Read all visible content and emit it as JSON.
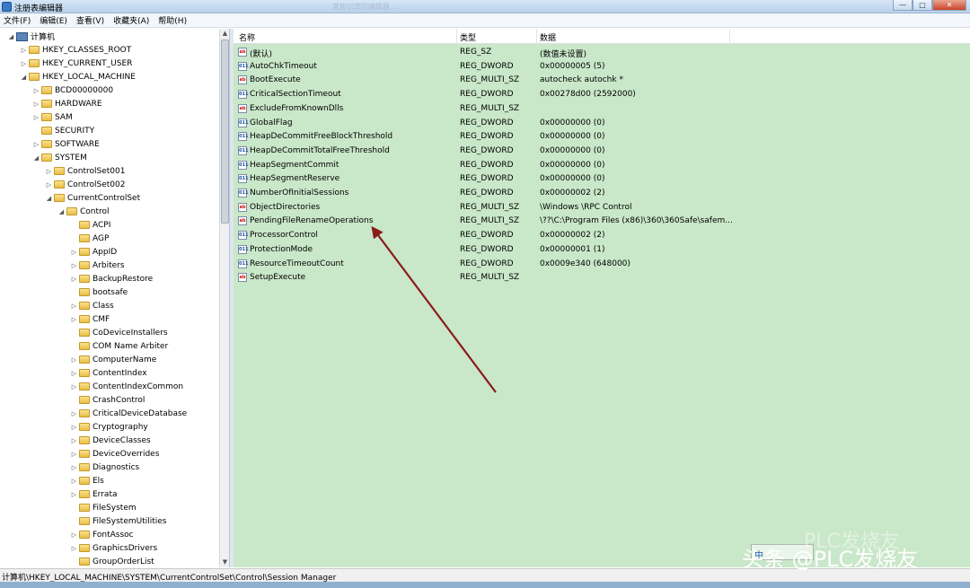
{
  "window": {
    "title": "注册表编辑器",
    "blurred_title": "某知识库的编辑器…",
    "controls": {
      "minimize": "—",
      "maximize": "□",
      "close": "✕"
    }
  },
  "menu": [
    "文件(F)",
    "编辑(E)",
    "查看(V)",
    "收藏夹(A)",
    "帮助(H)"
  ],
  "tree": [
    {
      "label": "计算机",
      "level": 0,
      "expander": "◢",
      "kind": "computer"
    },
    {
      "label": "HKEY_CLASSES_ROOT",
      "level": 1,
      "expander": "▷",
      "kind": "folder"
    },
    {
      "label": "HKEY_CURRENT_USER",
      "level": 1,
      "expander": "▷",
      "kind": "folder"
    },
    {
      "label": "HKEY_LOCAL_MACHINE",
      "level": 1,
      "expander": "◢",
      "kind": "folder"
    },
    {
      "label": "BCD00000000",
      "level": 2,
      "expander": "▷",
      "kind": "folder"
    },
    {
      "label": "HARDWARE",
      "level": 2,
      "expander": "▷",
      "kind": "folder"
    },
    {
      "label": "SAM",
      "level": 2,
      "expander": "▷",
      "kind": "folder"
    },
    {
      "label": "SECURITY",
      "level": 2,
      "expander": "",
      "kind": "folder"
    },
    {
      "label": "SOFTWARE",
      "level": 2,
      "expander": "▷",
      "kind": "folder"
    },
    {
      "label": "SYSTEM",
      "level": 2,
      "expander": "◢",
      "kind": "folder"
    },
    {
      "label": "ControlSet001",
      "level": 3,
      "expander": "▷",
      "kind": "folder"
    },
    {
      "label": "ControlSet002",
      "level": 3,
      "expander": "▷",
      "kind": "folder"
    },
    {
      "label": "CurrentControlSet",
      "level": 3,
      "expander": "◢",
      "kind": "folder"
    },
    {
      "label": "Control",
      "level": 4,
      "expander": "◢",
      "kind": "folder"
    },
    {
      "label": "ACPI",
      "level": 5,
      "expander": "",
      "kind": "folder"
    },
    {
      "label": "AGP",
      "level": 5,
      "expander": "",
      "kind": "folder"
    },
    {
      "label": "AppID",
      "level": 5,
      "expander": "▷",
      "kind": "folder"
    },
    {
      "label": "Arbiters",
      "level": 5,
      "expander": "▷",
      "kind": "folder"
    },
    {
      "label": "BackupRestore",
      "level": 5,
      "expander": "▷",
      "kind": "folder"
    },
    {
      "label": "bootsafe",
      "level": 5,
      "expander": "",
      "kind": "folder"
    },
    {
      "label": "Class",
      "level": 5,
      "expander": "▷",
      "kind": "folder"
    },
    {
      "label": "CMF",
      "level": 5,
      "expander": "▷",
      "kind": "folder"
    },
    {
      "label": "CoDeviceInstallers",
      "level": 5,
      "expander": "",
      "kind": "folder"
    },
    {
      "label": "COM Name Arbiter",
      "level": 5,
      "expander": "",
      "kind": "folder"
    },
    {
      "label": "ComputerName",
      "level": 5,
      "expander": "▷",
      "kind": "folder"
    },
    {
      "label": "ContentIndex",
      "level": 5,
      "expander": "▷",
      "kind": "folder"
    },
    {
      "label": "ContentIndexCommon",
      "level": 5,
      "expander": "▷",
      "kind": "folder"
    },
    {
      "label": "CrashControl",
      "level": 5,
      "expander": "",
      "kind": "folder"
    },
    {
      "label": "CriticalDeviceDatabase",
      "level": 5,
      "expander": "▷",
      "kind": "folder"
    },
    {
      "label": "Cryptography",
      "level": 5,
      "expander": "▷",
      "kind": "folder"
    },
    {
      "label": "DeviceClasses",
      "level": 5,
      "expander": "▷",
      "kind": "folder"
    },
    {
      "label": "DeviceOverrides",
      "level": 5,
      "expander": "▷",
      "kind": "folder"
    },
    {
      "label": "Diagnostics",
      "level": 5,
      "expander": "▷",
      "kind": "folder"
    },
    {
      "label": "Els",
      "level": 5,
      "expander": "▷",
      "kind": "folder"
    },
    {
      "label": "Errata",
      "level": 5,
      "expander": "▷",
      "kind": "folder"
    },
    {
      "label": "FileSystem",
      "level": 5,
      "expander": "",
      "kind": "folder"
    },
    {
      "label": "FileSystemUtilities",
      "level": 5,
      "expander": "",
      "kind": "folder"
    },
    {
      "label": "FontAssoc",
      "level": 5,
      "expander": "▷",
      "kind": "folder"
    },
    {
      "label": "GraphicsDrivers",
      "level": 5,
      "expander": "▷",
      "kind": "folder"
    },
    {
      "label": "GroupOrderList",
      "level": 5,
      "expander": "",
      "kind": "folder"
    }
  ],
  "list": {
    "columns": [
      "名称",
      "类型",
      "数据"
    ],
    "rows": [
      {
        "icon": "string",
        "name": "(默认)",
        "type": "REG_SZ",
        "data": "(数值未设置)"
      },
      {
        "icon": "binary",
        "name": "AutoChkTimeout",
        "type": "REG_DWORD",
        "data": "0x00000005 (5)"
      },
      {
        "icon": "string",
        "name": "BootExecute",
        "type": "REG_MULTI_SZ",
        "data": "autocheck autochk *"
      },
      {
        "icon": "binary",
        "name": "CriticalSectionTimeout",
        "type": "REG_DWORD",
        "data": "0x00278d00 (2592000)"
      },
      {
        "icon": "string",
        "name": "ExcludeFromKnownDlls",
        "type": "REG_MULTI_SZ",
        "data": ""
      },
      {
        "icon": "binary",
        "name": "GlobalFlag",
        "type": "REG_DWORD",
        "data": "0x00000000 (0)"
      },
      {
        "icon": "binary",
        "name": "HeapDeCommitFreeBlockThreshold",
        "type": "REG_DWORD",
        "data": "0x00000000 (0)"
      },
      {
        "icon": "binary",
        "name": "HeapDeCommitTotalFreeThreshold",
        "type": "REG_DWORD",
        "data": "0x00000000 (0)"
      },
      {
        "icon": "binary",
        "name": "HeapSegmentCommit",
        "type": "REG_DWORD",
        "data": "0x00000000 (0)"
      },
      {
        "icon": "binary",
        "name": "HeapSegmentReserve",
        "type": "REG_DWORD",
        "data": "0x00000000 (0)"
      },
      {
        "icon": "binary",
        "name": "NumberOfInitialSessions",
        "type": "REG_DWORD",
        "data": "0x00000002 (2)"
      },
      {
        "icon": "string",
        "name": "ObjectDirectories",
        "type": "REG_MULTI_SZ",
        "data": "\\Windows \\RPC Control"
      },
      {
        "icon": "string",
        "name": "PendingFileRenameOperations",
        "type": "REG_MULTI_SZ",
        "data": "\\??\\C:\\Program Files (x86)\\360\\360Safe\\safem..."
      },
      {
        "icon": "binary",
        "name": "ProcessorControl",
        "type": "REG_DWORD",
        "data": "0x00000002 (2)"
      },
      {
        "icon": "binary",
        "name": "ProtectionMode",
        "type": "REG_DWORD",
        "data": "0x00000001 (1)"
      },
      {
        "icon": "binary",
        "name": "ResourceTimeoutCount",
        "type": "REG_DWORD",
        "data": "0x0009e340 (648000)"
      },
      {
        "icon": "string",
        "name": "SetupExecute",
        "type": "REG_MULTI_SZ",
        "data": ""
      }
    ],
    "icon_glyphs": {
      "string": "ab",
      "binary": "011"
    },
    "background_color": "#c9e7c9"
  },
  "annotation": {
    "arrow_color": "#8b1a1a"
  },
  "status": "计算机\\HKEY_LOCAL_MACHINE\\SYSTEM\\CurrentControlSet\\Control\\Session Manager",
  "watermark": {
    "text": "头条 @PLC发烧友",
    "faint_text": "PLC发烧友",
    "ime_label": "中"
  }
}
